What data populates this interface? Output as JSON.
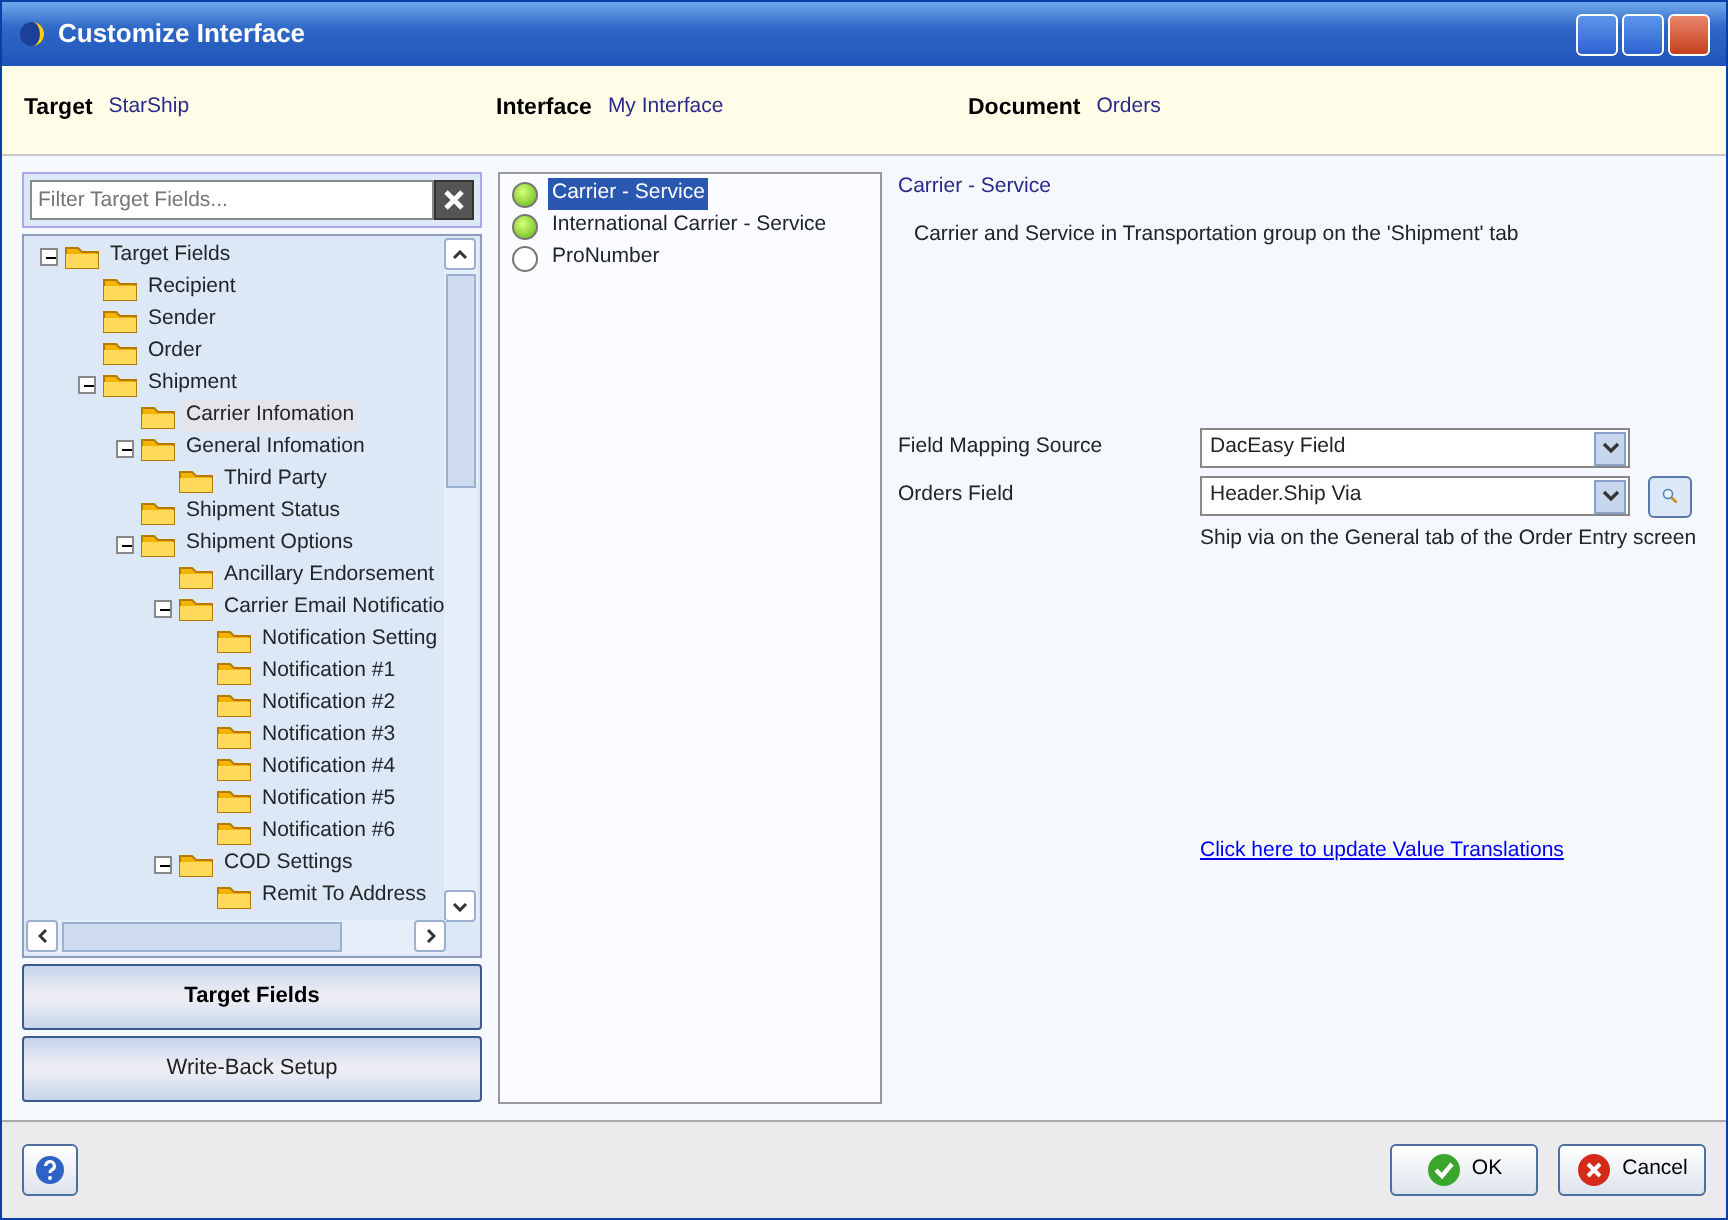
{
  "window": {
    "title": "Customize Interface"
  },
  "header": [
    {
      "label": "Target",
      "value": "StarShip"
    },
    {
      "label": "Interface",
      "value": "My Interface"
    },
    {
      "label": "Document",
      "value": "Orders"
    }
  ],
  "filter": {
    "placeholder": "Filter Target Fields..."
  },
  "tree": [
    {
      "label": "Target Fields",
      "expanded": true,
      "selected": false,
      "children": [
        {
          "label": "Recipient",
          "selected": false
        },
        {
          "label": "Sender",
          "selected": false
        },
        {
          "label": "Order",
          "selected": false
        },
        {
          "label": "Shipment",
          "expanded": true,
          "selected": false,
          "children": [
            {
              "label": "Carrier Infomation",
              "selected": true
            },
            {
              "label": "General Infomation",
              "expanded": true,
              "selected": false,
              "children": [
                {
                  "label": "Third Party",
                  "selected": false
                }
              ]
            },
            {
              "label": "Shipment Status",
              "selected": false
            },
            {
              "label": "Shipment Options",
              "expanded": true,
              "selected": false,
              "children": [
                {
                  "label": "Ancillary Endorsement",
                  "selected": false
                },
                {
                  "label": "Carrier Email Notificatio",
                  "expanded": true,
                  "selected": false,
                  "children": [
                    {
                      "label": "Notification Setting",
                      "selected": false
                    },
                    {
                      "label": "Notification #1",
                      "selected": false
                    },
                    {
                      "label": "Notification #2",
                      "selected": false
                    },
                    {
                      "label": "Notification #3",
                      "selected": false
                    },
                    {
                      "label": "Notification #4",
                      "selected": false
                    },
                    {
                      "label": "Notification #5",
                      "selected": false
                    },
                    {
                      "label": "Notification #6",
                      "selected": false
                    }
                  ]
                },
                {
                  "label": "COD Settings",
                  "expanded": true,
                  "selected": false,
                  "children": [
                    {
                      "label": "Remit To Address",
                      "selected": false
                    }
                  ]
                }
              ]
            }
          ]
        }
      ]
    }
  ],
  "side_tabs": [
    {
      "label": "Target Fields",
      "selected": true
    },
    {
      "label": "Write-Back Setup",
      "selected": false
    }
  ],
  "fields_list": [
    {
      "label": "Carrier - Service",
      "mapped": true,
      "selected": true
    },
    {
      "label": "International Carrier - Service",
      "mapped": true,
      "selected": false
    },
    {
      "label": "ProNumber",
      "mapped": false,
      "selected": false
    }
  ],
  "detail": {
    "title": "Carrier - Service",
    "description": "Carrier and Service in Transportation group on the 'Shipment' tab",
    "rows": [
      {
        "label": "Field Mapping Source",
        "value": "DacEasy Field",
        "search": false
      },
      {
        "label": "Orders Field",
        "value": "Header.Ship Via",
        "search": true,
        "hint": "Ship via on the General tab of the Order Entry screen"
      }
    ],
    "link": "Click here to update Value Translations"
  },
  "buttons": [
    {
      "kind": "ok",
      "label": "OK"
    },
    {
      "kind": "cancel",
      "label": "Cancel"
    }
  ]
}
